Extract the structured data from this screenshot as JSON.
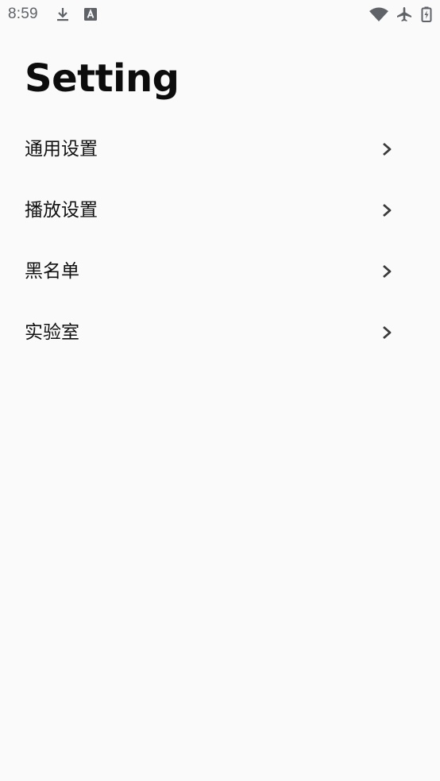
{
  "status_bar": {
    "time": "8:59",
    "left_icons": [
      "download-icon",
      "text-badge-icon"
    ],
    "right_icons": [
      "wifi-icon",
      "airplane-mode-icon",
      "battery-charging-icon"
    ]
  },
  "page": {
    "title": "Setting"
  },
  "settings": {
    "items": [
      {
        "label": "通用设置",
        "icon": "chevron-right-icon"
      },
      {
        "label": "播放设置",
        "icon": "chevron-right-icon"
      },
      {
        "label": "黑名单",
        "icon": "chevron-right-icon"
      },
      {
        "label": "实验室",
        "icon": "chevron-right-icon"
      }
    ]
  },
  "colors": {
    "background": "#fafafa",
    "text": "#111111",
    "status_icon": "#5f6368",
    "chevron": "#3a3a3a"
  }
}
